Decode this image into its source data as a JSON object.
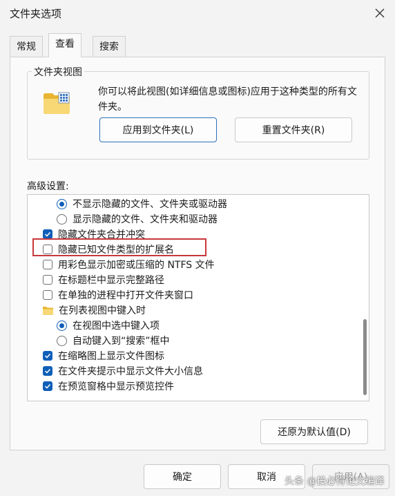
{
  "window": {
    "title": "文件夹选项"
  },
  "tabs": [
    {
      "label": "常规"
    },
    {
      "label": "查看"
    },
    {
      "label": "搜索"
    }
  ],
  "folder_views": {
    "legend": "文件夹视图",
    "description": "你可以将此视图(如详细信息或图标)应用于这种类型的所有文件夹。",
    "apply_button": "应用到文件夹(L)",
    "reset_button": "重置文件夹(R)"
  },
  "advanced": {
    "label": "高级设置:",
    "items": [
      {
        "type": "radio",
        "checked": true,
        "label": "不显示隐藏的文件、文件夹或驱动器"
      },
      {
        "type": "radio",
        "checked": false,
        "label": "显示隐藏的文件、文件夹和驱动器"
      },
      {
        "type": "checkbox",
        "checked": true,
        "label": "隐藏文件夹合并冲突"
      },
      {
        "type": "checkbox",
        "checked": false,
        "label": "隐藏已知文件类型的扩展名"
      },
      {
        "type": "checkbox",
        "checked": false,
        "label": "用彩色显示加密或压缩的 NTFS 文件"
      },
      {
        "type": "checkbox",
        "checked": false,
        "label": "在标题栏中显示完整路径"
      },
      {
        "type": "checkbox",
        "checked": false,
        "label": "在单独的进程中打开文件夹窗口"
      },
      {
        "type": "folder",
        "label": "在列表视图中键入时"
      },
      {
        "type": "radio",
        "checked": true,
        "label": "在视图中选中键入项"
      },
      {
        "type": "radio",
        "checked": false,
        "label": "自动键入到“搜索”框中"
      },
      {
        "type": "checkbox",
        "checked": true,
        "label": "在缩略图上显示文件图标"
      },
      {
        "type": "checkbox",
        "checked": true,
        "label": "在文件夹提示中显示文件大小信息"
      },
      {
        "type": "checkbox",
        "checked": true,
        "label": "在预览窗格中显示预览控件"
      }
    ]
  },
  "restore_defaults_button": "还原为默认值(D)",
  "footer": {
    "ok": "确定",
    "cancel": "取消",
    "apply": "应用(A)"
  },
  "watermark": "头条 @投必得论文编译",
  "colors": {
    "accent": "#0f5fb8",
    "highlight_border": "#c8373a"
  }
}
